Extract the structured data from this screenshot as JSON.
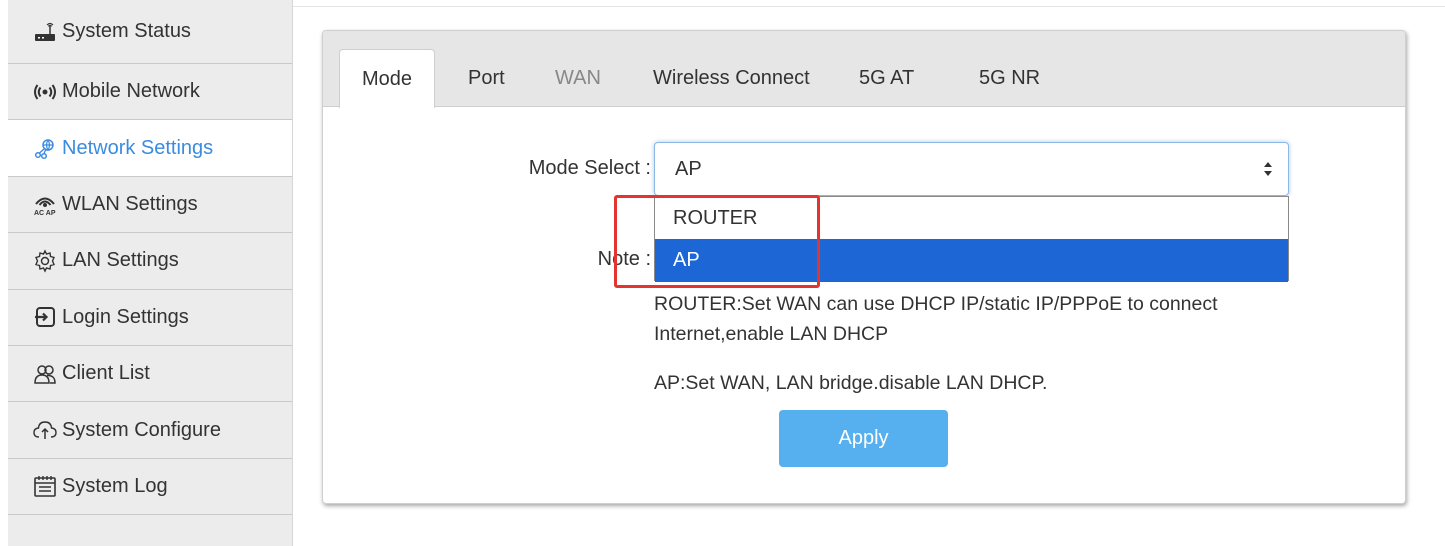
{
  "sidebar": {
    "items": [
      {
        "label": "System Status",
        "icon": "router-icon"
      },
      {
        "label": "Mobile Network",
        "icon": "signal-icon"
      },
      {
        "label": "Network Settings",
        "icon": "network-icon",
        "active": true
      },
      {
        "label": "WLAN Settings",
        "icon": "wifi-acap-icon"
      },
      {
        "label": "LAN Settings",
        "icon": "gear-icon"
      },
      {
        "label": "Login Settings",
        "icon": "login-icon"
      },
      {
        "label": "Client List",
        "icon": "users-icon"
      },
      {
        "label": "System Configure",
        "icon": "cloud-upload-icon"
      },
      {
        "label": "System Log",
        "icon": "calendar-log-icon"
      }
    ]
  },
  "tabs": [
    {
      "label": "Mode",
      "active": true
    },
    {
      "label": "Port"
    },
    {
      "label": "WAN",
      "muted": true
    },
    {
      "label": "Wireless Connect"
    },
    {
      "label": "5G AT"
    },
    {
      "label": "5G NR"
    }
  ],
  "form": {
    "mode_label": "Mode Select :",
    "mode_value": "AP",
    "options": [
      "ROUTER",
      "AP"
    ],
    "note_label": "Note :",
    "note_router": "ROUTER:Set WAN can use DHCP IP/static IP/PPPoE to connect Internet,enable LAN DHCP",
    "note_ap": "AP:Set WAN, LAN bridge.disable LAN DHCP.",
    "apply_label": "Apply"
  },
  "colors": {
    "accent": "#3b8be0",
    "selected_option": "#1c66d6",
    "apply_button": "#56b0f0",
    "highlight_box": "#e3342f"
  }
}
